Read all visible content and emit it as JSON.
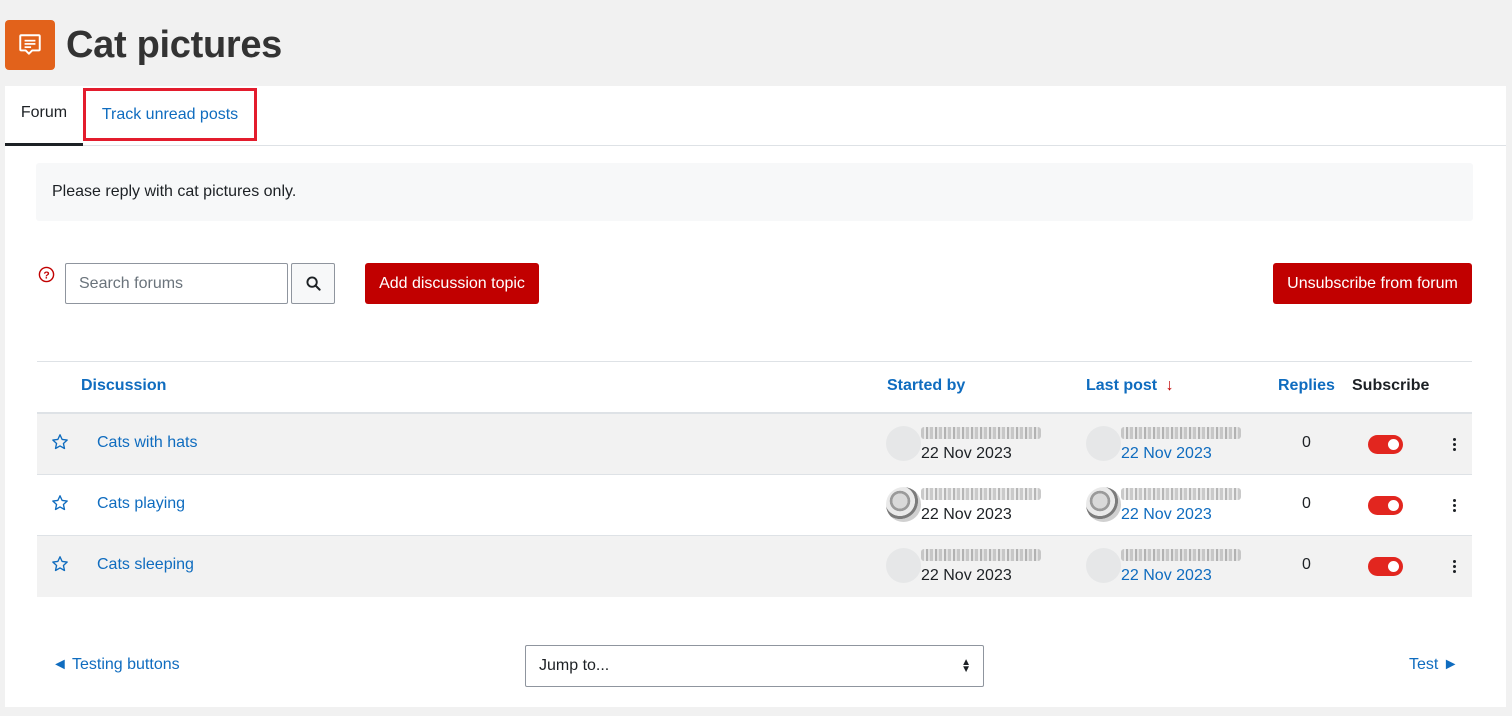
{
  "page": {
    "title": "Cat pictures",
    "icon": "forum-chat-icon",
    "accent_color": "#e2621b"
  },
  "tabs": [
    {
      "label": "Forum",
      "active": true
    },
    {
      "label": "Track unread posts",
      "active": false,
      "highlighted": true
    }
  ],
  "intro": "Please reply with cat pictures only.",
  "search": {
    "placeholder": "Search forums",
    "value": ""
  },
  "buttons": {
    "add_topic": "Add discussion topic",
    "unsubscribe": "Unsubscribe from forum"
  },
  "table": {
    "headers": {
      "discussion": "Discussion",
      "started_by": "Started by",
      "last_post": "Last post",
      "last_post_sort": "↓",
      "replies": "Replies",
      "subscribe": "Subscribe"
    },
    "rows": [
      {
        "topic": "Cats with hats",
        "started_date": "22 Nov 2023",
        "last_post_date": "22 Nov 2023",
        "replies": "0",
        "subscribed": true,
        "starred": false
      },
      {
        "topic": "Cats playing",
        "started_date": "22 Nov 2023",
        "last_post_date": "22 Nov 2023",
        "replies": "0",
        "subscribed": true,
        "starred": false
      },
      {
        "topic": "Cats sleeping",
        "started_date": "22 Nov 2023",
        "last_post_date": "22 Nov 2023",
        "replies": "0",
        "subscribed": true,
        "starred": false
      }
    ]
  },
  "nav": {
    "prev": "◄ Testing buttons",
    "jump_to": "Jump to...",
    "next": "Test ►"
  },
  "colors": {
    "primary_button": "#c10000",
    "link": "#0f6cbf",
    "toggle_on": "#e2261f",
    "highlight_box": "#e31c2d"
  }
}
